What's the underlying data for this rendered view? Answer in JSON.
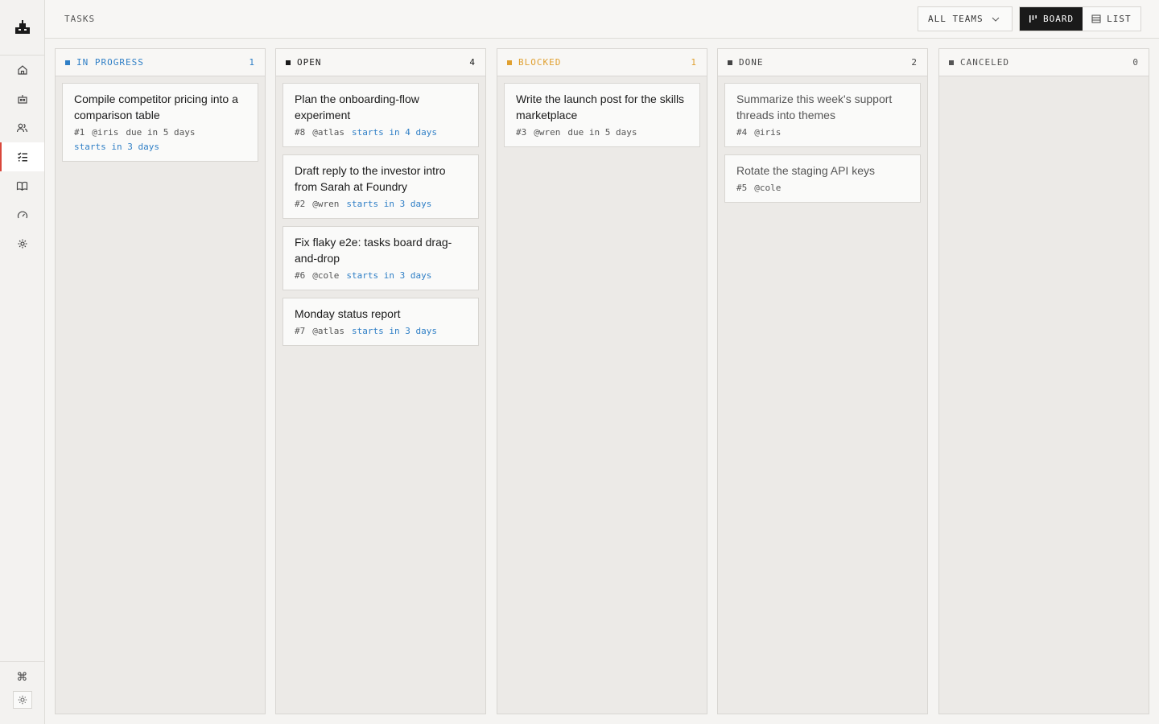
{
  "header": {
    "title": "TASKS",
    "team_filter": "ALL TEAMS",
    "view_board": "BOARD",
    "view_list": "LIST"
  },
  "sidebar": {
    "items": [
      {
        "icon": "home-icon"
      },
      {
        "icon": "robot-icon"
      },
      {
        "icon": "users-icon"
      },
      {
        "icon": "tasks-icon",
        "active": true
      },
      {
        "icon": "book-icon"
      },
      {
        "icon": "gauge-icon"
      },
      {
        "icon": "settings-icon"
      }
    ],
    "command_glyph": "⌘"
  },
  "colors": {
    "in_progress": "#2f7fc6",
    "blocked": "#e0a030",
    "active_nav": "#d9473b"
  },
  "columns": [
    {
      "title": "IN PROGRESS",
      "count": "1",
      "cards": [
        {
          "title": "Compile competitor pricing into a comparison table",
          "id": "#1",
          "assignee": "@iris",
          "due": "due in 5 days",
          "starts": "starts in 3 days"
        }
      ]
    },
    {
      "title": "OPEN",
      "count": "4",
      "cards": [
        {
          "title": "Plan the onboarding-flow experiment",
          "id": "#8",
          "assignee": "@atlas",
          "starts": "starts in 4 days"
        },
        {
          "title": "Draft reply to the investor intro from Sarah at Foundry",
          "id": "#2",
          "assignee": "@wren",
          "starts": "starts in 3 days"
        },
        {
          "title": "Fix flaky e2e: tasks board drag-and-drop",
          "id": "#6",
          "assignee": "@cole",
          "starts": "starts in 3 days"
        },
        {
          "title": "Monday status report",
          "id": "#7",
          "assignee": "@atlas",
          "starts": "starts in 3 days"
        }
      ]
    },
    {
      "title": "BLOCKED",
      "count": "1",
      "cards": [
        {
          "title": "Write the launch post for the skills marketplace",
          "id": "#3",
          "assignee": "@wren",
          "due": "due in 5 days"
        }
      ]
    },
    {
      "title": "DONE",
      "count": "2",
      "cards": [
        {
          "title": "Summarize this week's support threads into themes",
          "id": "#4",
          "assignee": "@iris"
        },
        {
          "title": "Rotate the staging API keys",
          "id": "#5",
          "assignee": "@cole"
        }
      ]
    },
    {
      "title": "CANCELED",
      "count": "0",
      "cards": []
    }
  ]
}
